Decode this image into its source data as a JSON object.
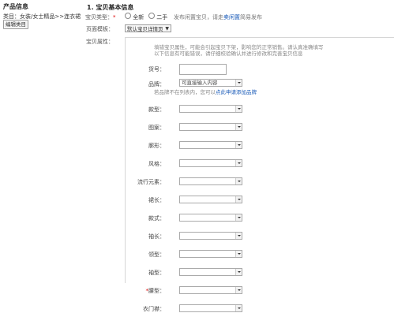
{
  "sidebar": {
    "title": "产品信息",
    "category": "类目：女装/女士精品>>连衣裙",
    "edit_category_button": "编辑类目"
  },
  "section": {
    "title": "1. 宝贝基本信息"
  },
  "item_type": {
    "label": "宝贝类型：",
    "required_mark": "*",
    "options": [
      "全新",
      "二手"
    ],
    "note_prefix": "发布闲置宝贝，请走",
    "note_link": "卖闲置",
    "note_suffix": "简易发布"
  },
  "template": {
    "label": "页面模板：",
    "value": "默认宝贝详情页"
  },
  "attributes": {
    "label": "宝贝属性：",
    "note": "填错宝贝属性，可能会引起宝贝下架，影响您的正常销售。请认真准确填写",
    "note2": "以下信息有可能错误，请仔细校验确认并进行修改和完善宝贝信息",
    "article_no": {
      "label": "货号：",
      "value": ""
    },
    "brand": {
      "label": "品牌：",
      "value": "可直接输入内容"
    },
    "brand_note_prefix": "若品牌不在列表内，您可以",
    "brand_note_link": "点此申请添加品牌",
    "fields": [
      {
        "label": "款型：",
        "required": false
      },
      {
        "label": "图案：",
        "required": false
      },
      {
        "label": "廓形：",
        "required": false
      },
      {
        "label": "风格：",
        "required": false
      },
      {
        "label": "流行元素：",
        "required": false
      },
      {
        "label": "裙长：",
        "required": false
      },
      {
        "label": "款式：",
        "required": false
      },
      {
        "label": "袖长：",
        "required": false
      },
      {
        "label": "领型：",
        "required": false
      },
      {
        "label": "袖型：",
        "required": false
      },
      {
        "label": "腰型：",
        "required": true
      },
      {
        "label": "衣门襟：",
        "required": false
      }
    ]
  }
}
